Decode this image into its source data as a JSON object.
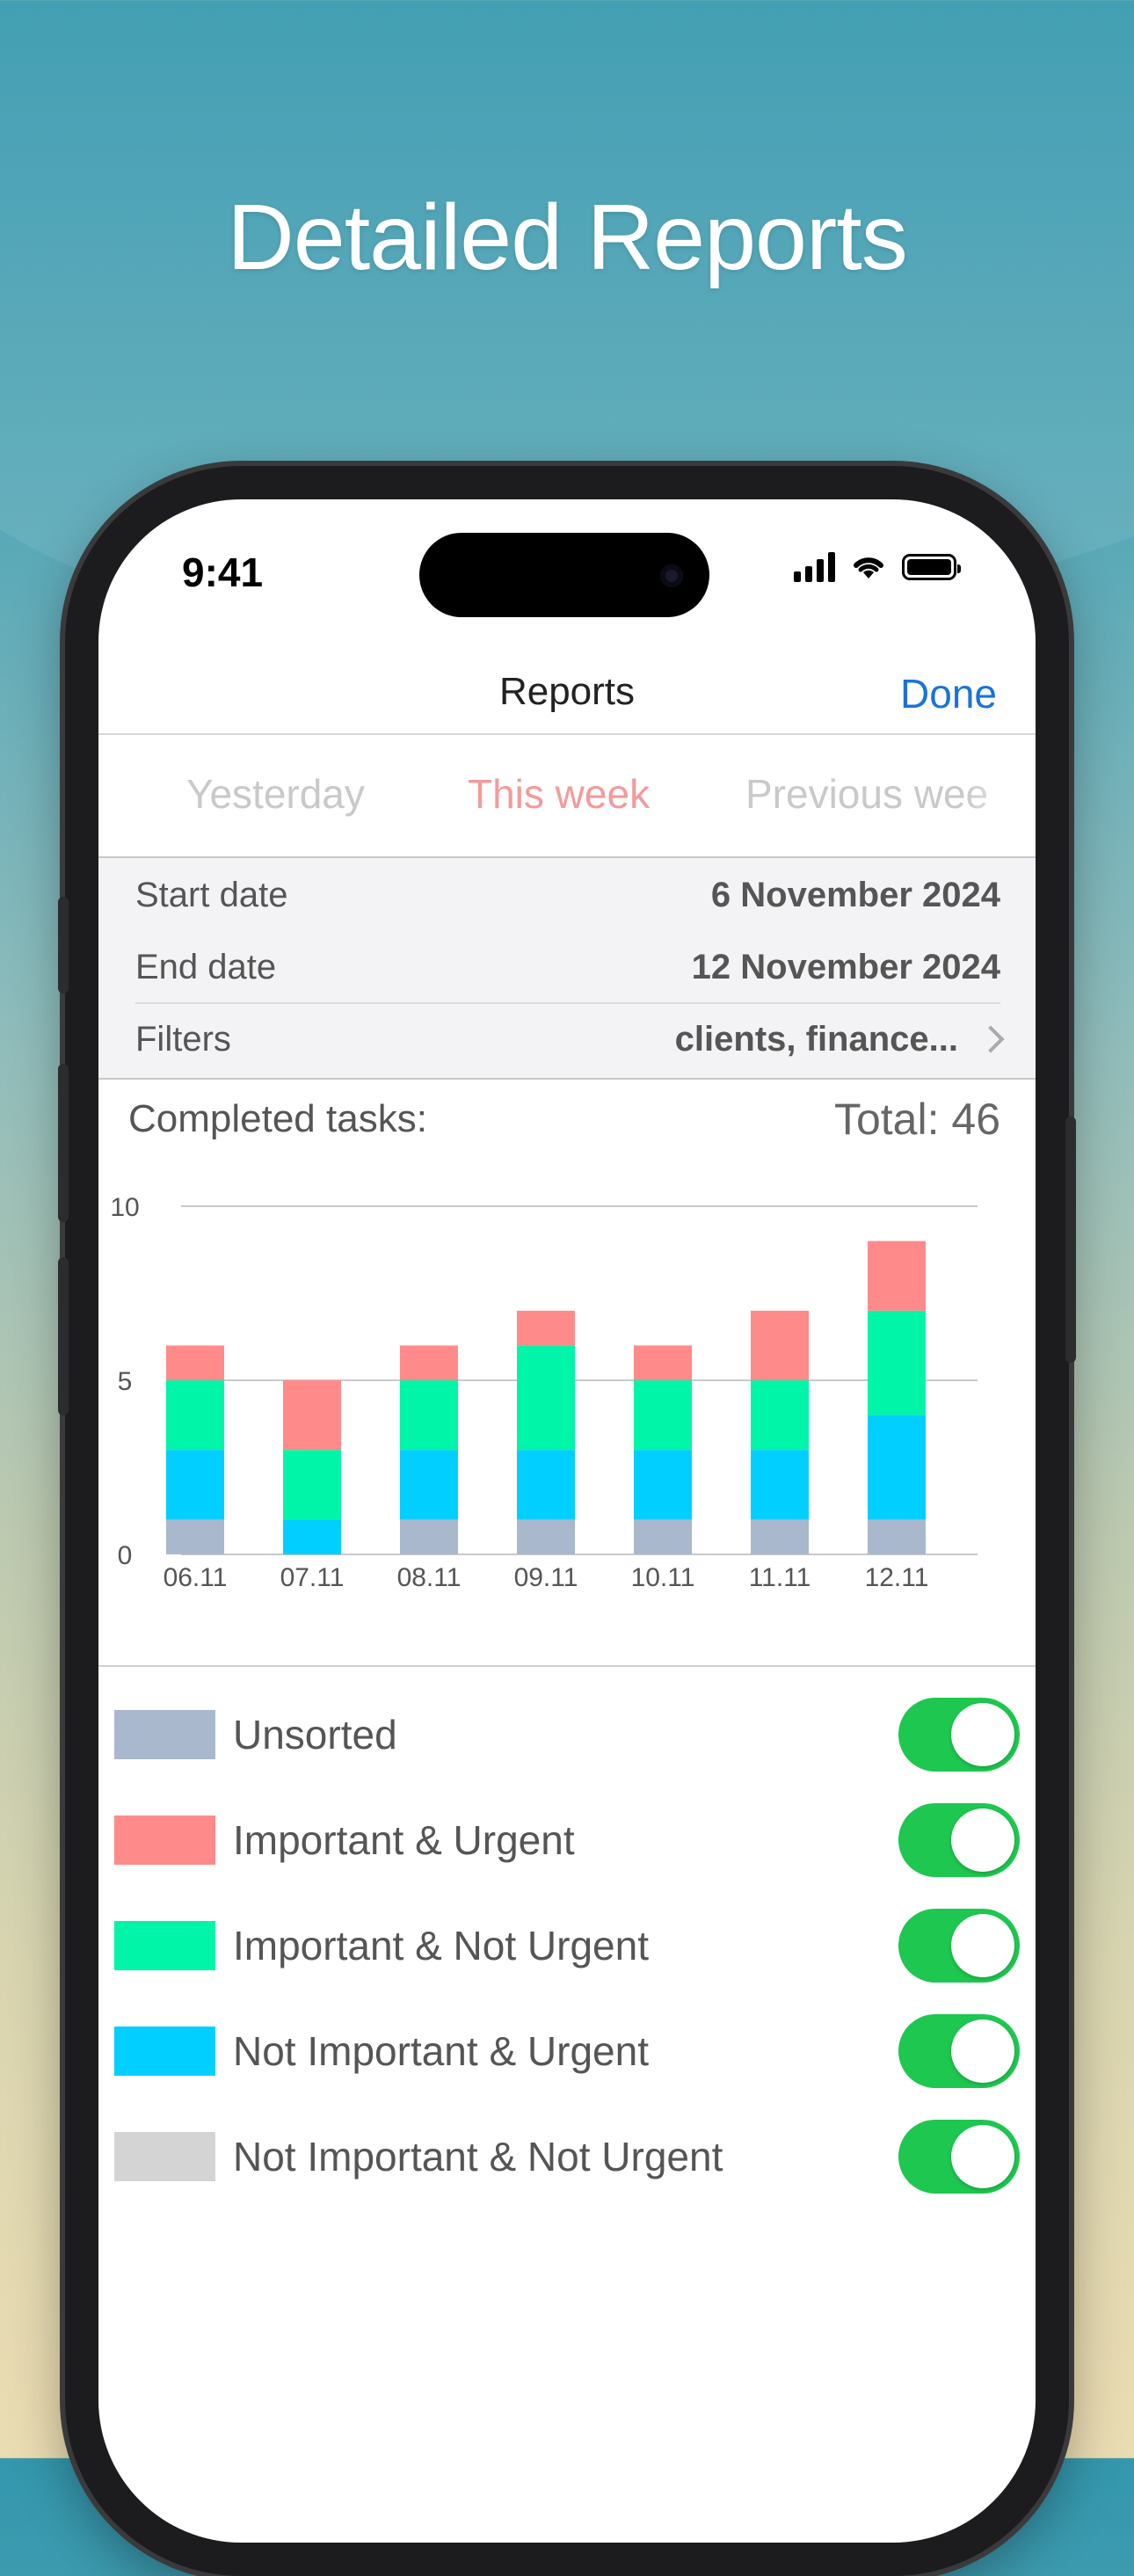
{
  "headline": "Detailed Reports",
  "status_bar": {
    "time": "9:41"
  },
  "nav": {
    "title": "Reports",
    "done": "Done"
  },
  "segments": [
    {
      "label": "Yesterday",
      "active": false
    },
    {
      "label": "This week",
      "active": true
    },
    {
      "label": "Previous wee",
      "active": false
    }
  ],
  "params": {
    "start_label": "Start date",
    "start_value": "6 November 2024",
    "end_label": "End date",
    "end_value": "12 November 2024",
    "filters_label": "Filters",
    "filters_value": "clients, finance..."
  },
  "summary": {
    "label": "Completed tasks:",
    "total": "Total: 46"
  },
  "chart_data": {
    "type": "bar",
    "stacked": true,
    "categories": [
      "06.11",
      "07.11",
      "08.11",
      "09.11",
      "10.11",
      "11.11",
      "12.11"
    ],
    "ylim": [
      0,
      10
    ],
    "yticks": [
      "0",
      "5",
      "10"
    ],
    "grid": true,
    "series": [
      {
        "name": "Unsorted",
        "color": "#a9b8cc",
        "values": [
          1,
          0,
          1,
          1,
          1,
          1,
          1
        ]
      },
      {
        "name": "Not Important & Urgent",
        "color": "#00cfff",
        "values": [
          2,
          1,
          2,
          2,
          2,
          2,
          3
        ]
      },
      {
        "name": "Important & Not Urgent",
        "color": "#00f5a8",
        "values": [
          2,
          2,
          2,
          3,
          2,
          2,
          3
        ]
      },
      {
        "name": "Important & Urgent",
        "color": "#ff8a8a",
        "values": [
          1,
          2,
          1,
          1,
          1,
          2,
          2
        ]
      }
    ]
  },
  "legend": [
    {
      "label": "Unsorted",
      "color": "#a9b8cc",
      "on": true
    },
    {
      "label": "Important & Urgent",
      "color": "#ff8a8a",
      "on": true
    },
    {
      "label": "Important & Not Urgent",
      "color": "#00f5a8",
      "on": true
    },
    {
      "label": "Not Important & Urgent",
      "color": "#00cfff",
      "on": true
    },
    {
      "label": "Not Important & Not Urgent",
      "color": "#d4d4d4",
      "on": true
    }
  ]
}
